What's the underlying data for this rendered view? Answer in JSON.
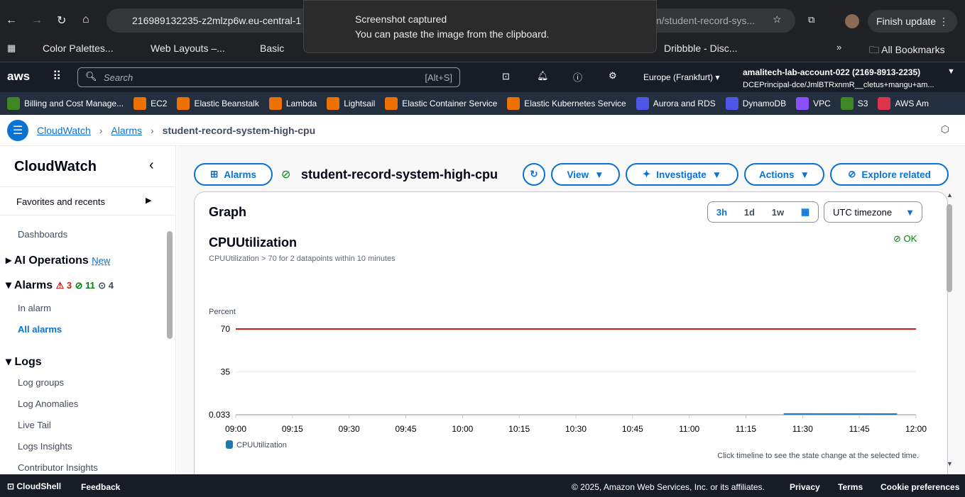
{
  "browser": {
    "url": "216989132235-z2mlzp6w.eu-central-1",
    "url_tail": "m/student-record-sys...",
    "finish_update": "Finish update",
    "toast_title": "Screenshot captured",
    "toast_body": "You can paste the image from the clipboard.",
    "bookmarks": [
      "Color Palettes...",
      "Web Layouts –...",
      "Basic",
      "Dribbble - Disc..."
    ],
    "all_bookmarks": "All Bookmarks"
  },
  "aws": {
    "logo": "aws",
    "search_placeholder": "Search",
    "search_shortcut": "[Alt+S]",
    "region": "Europe (Frankfurt)",
    "account": "amalitech-lab-account-022 (2169-8913-2235)",
    "principal": "DCEPrincipal-dce/JmlBTRxnmR__cletus+mangu+am...",
    "services": [
      {
        "label": "Billing and Cost Manage...",
        "color": "#3f8624"
      },
      {
        "label": "EC2",
        "color": "#ed7100"
      },
      {
        "label": "Elastic Beanstalk",
        "color": "#ed7100"
      },
      {
        "label": "Lambda",
        "color": "#ed7100"
      },
      {
        "label": "Lightsail",
        "color": "#ed7100"
      },
      {
        "label": "Elastic Container Service",
        "color": "#ed7100"
      },
      {
        "label": "Elastic Kubernetes Service",
        "color": "#ed7100"
      },
      {
        "label": "Aurora and RDS",
        "color": "#4d56e6"
      },
      {
        "label": "DynamoDB",
        "color": "#4d56e6"
      },
      {
        "label": "VPC",
        "color": "#8c4fff"
      },
      {
        "label": "S3",
        "color": "#3f8624"
      },
      {
        "label": "AWS Am",
        "color": "#dd344c"
      }
    ]
  },
  "breadcrumb": [
    "CloudWatch",
    "Alarms",
    "student-record-system-high-cpu"
  ],
  "sidebar": {
    "title": "CloudWatch",
    "favorites": "Favorites and recents",
    "dashboards": "Dashboards",
    "ai_ops": "AI Operations",
    "new_badge": "New",
    "alarms": "Alarms",
    "alarm_counts": {
      "in_alarm": "3",
      "ok": "11",
      "insufficient": "4"
    },
    "in_alarm": "In alarm",
    "all_alarms": "All alarms",
    "logs": "Logs",
    "log_items": [
      "Log groups",
      "Log Anomalies",
      "Live Tail",
      "Logs Insights",
      "Contributor Insights"
    ]
  },
  "header": {
    "alarms_btn": "Alarms",
    "alarm_name": "student-record-system-high-cpu",
    "view": "View",
    "investigate": "Investigate",
    "actions": "Actions",
    "explore": "Explore related"
  },
  "graph": {
    "title": "Graph",
    "ranges": [
      "3h",
      "1d",
      "1w"
    ],
    "active_range": "3h",
    "timezone": "UTC timezone",
    "metric": "CPUUtilization",
    "condition": "CPUUtilization > 70 for 2 datapoints within 10 minutes",
    "state": "OK",
    "hint": "Click timeline to see the state change at the selected time."
  },
  "chart_data": {
    "type": "line",
    "ylabel": "Percent",
    "yticks": [
      "70",
      "35",
      "0.033"
    ],
    "xticks": [
      "09:00",
      "09:15",
      "09:30",
      "09:45",
      "10:00",
      "10:15",
      "10:30",
      "10:45",
      "11:00",
      "11:15",
      "11:30",
      "11:45",
      "12:00"
    ],
    "threshold": 70,
    "threshold_color": "#d91515",
    "series": [
      {
        "name": "CPUUtilization",
        "color": "#1f78b4",
        "x": [
          "11:25",
          "11:55"
        ],
        "y": [
          0.04,
          0.033
        ]
      }
    ]
  },
  "footer": {
    "cloudshell": "CloudShell",
    "feedback": "Feedback",
    "copyright": "© 2025, Amazon Web Services, Inc. or its affiliates.",
    "privacy": "Privacy",
    "terms": "Terms",
    "cookies": "Cookie preferences"
  }
}
